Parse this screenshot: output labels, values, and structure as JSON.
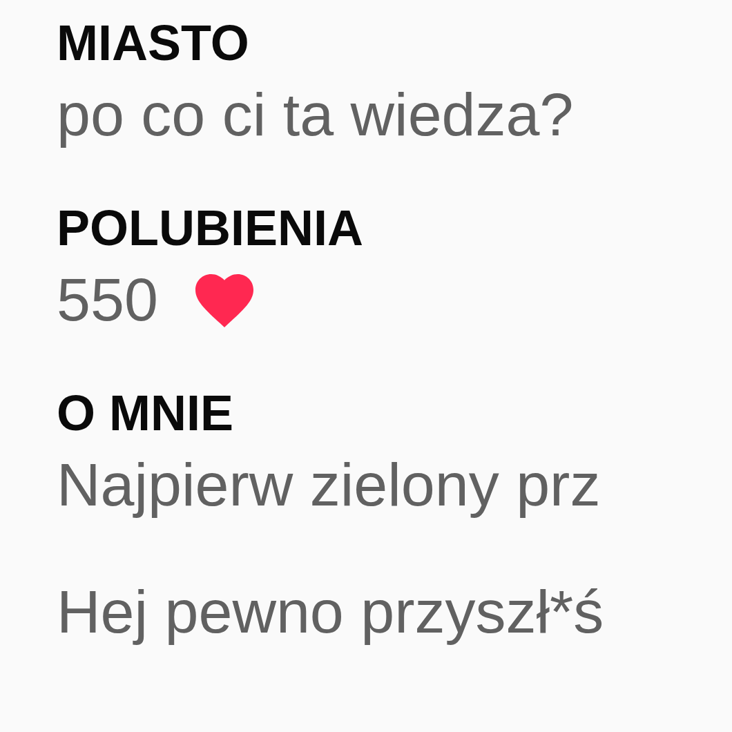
{
  "sections": [
    {
      "heading": "MIASTO",
      "lines": [
        "po co ci ta wiedza?"
      ]
    },
    {
      "heading": "POLUBIENIA",
      "lines": [
        "550"
      ],
      "liked": true
    },
    {
      "heading": "O MNIE",
      "lines": [
        "Najpierw zielony prz",
        "Hej pewno przyszł*ś"
      ]
    }
  ]
}
